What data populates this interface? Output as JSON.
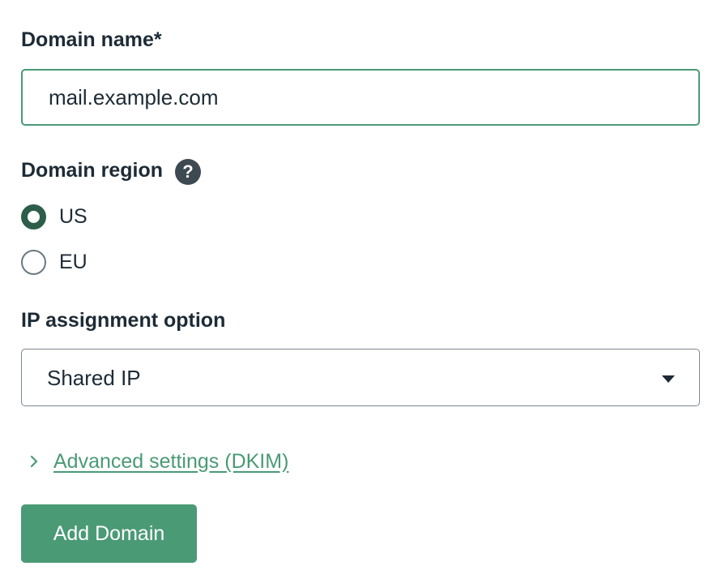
{
  "domain_name": {
    "label": "Domain name*",
    "value": "mail.example.com"
  },
  "domain_region": {
    "label": "Domain region",
    "help_icon": "?",
    "options": [
      {
        "label": "US",
        "checked": true
      },
      {
        "label": "EU",
        "checked": false
      }
    ]
  },
  "ip_assignment": {
    "label": "IP assignment option",
    "selected": "Shared IP"
  },
  "advanced": {
    "link_label": "Advanced settings (DKIM)"
  },
  "actions": {
    "add_domain_label": "Add Domain"
  },
  "colors": {
    "accent": "#4a9a76",
    "text": "#1d2b36",
    "radio_checked": "#2d5e4a",
    "help_icon_bg": "#3e4a52"
  },
  "icons": {
    "help": "question-circle-icon",
    "caret": "caret-down-icon",
    "chevron": "chevron-right-icon"
  }
}
